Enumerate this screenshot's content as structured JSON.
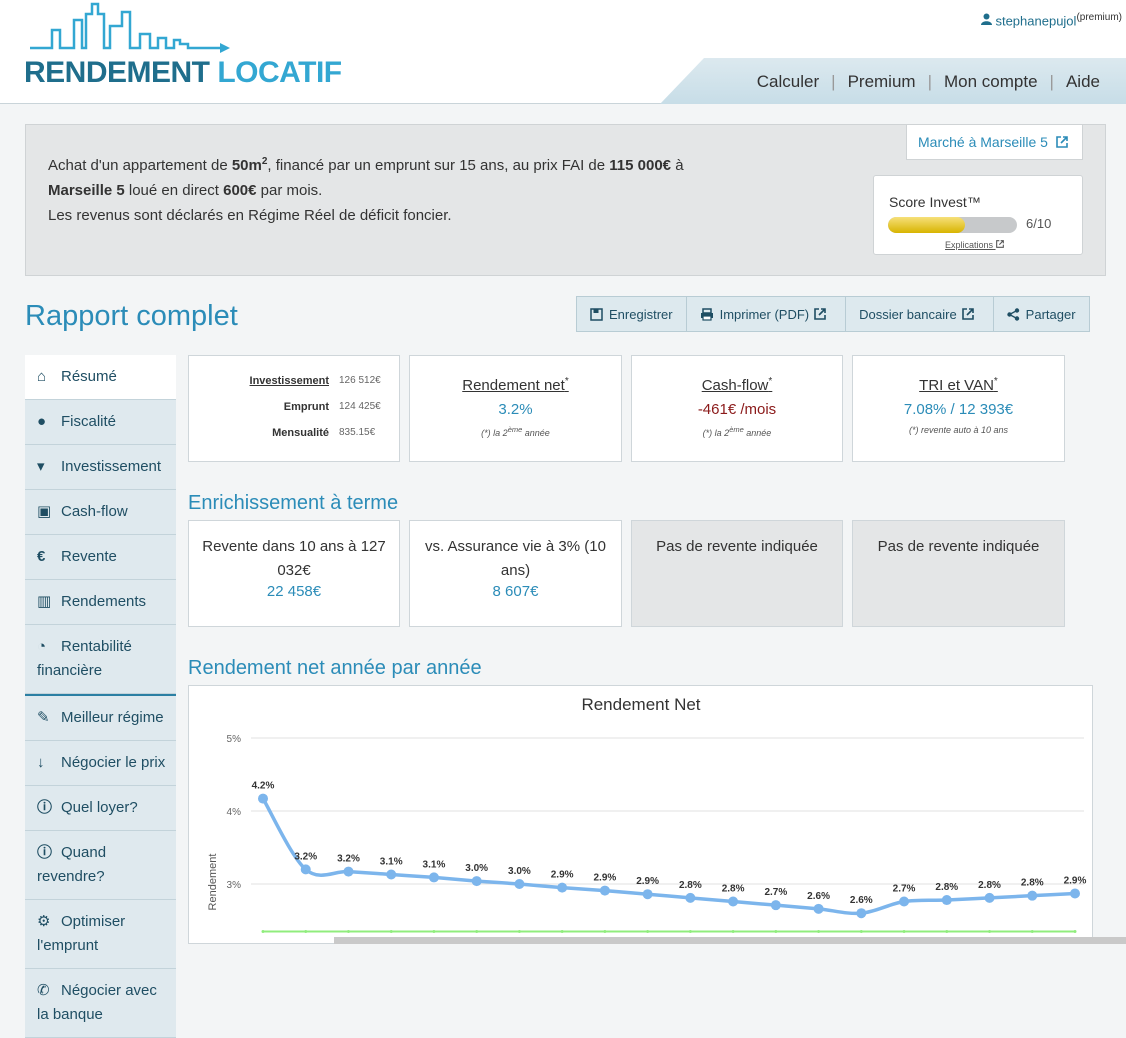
{
  "header": {
    "logo": {
      "part1": "RENDEMENT",
      "part2": "LOCATIF"
    },
    "user": {
      "name": "stephanepujol",
      "badge": "(premium)"
    },
    "nav": [
      "Calculer",
      "Premium",
      "Mon compte",
      "Aide"
    ]
  },
  "summary": {
    "t1": "Achat d'un appartement de ",
    "surface": "50m",
    "surface_sup": "2",
    "t2": ", financé par un emprunt sur 15 ans, au prix FAI de ",
    "price": "115 000€",
    "t3": " à",
    "city": "Marseille 5",
    "t4": " loué en direct ",
    "rent": "600€",
    "t5": " par mois.",
    "t6": "Les revenus sont déclarés en Régime Réel de déficit foncier.",
    "market_link": "Marché à Marseille 5",
    "score": {
      "title": "Score Invest™",
      "value": "6/10",
      "fraction": 0.6,
      "link": "Explications"
    }
  },
  "page_title": "Rapport complet",
  "toolbar": {
    "save": "Enregistrer",
    "print": "Imprimer (PDF)",
    "bank": "Dossier bancaire",
    "share": "Partager"
  },
  "sidebar": [
    {
      "label": "Résumé",
      "icon": "home-icon"
    },
    {
      "label": "Fiscalité",
      "icon": "user-icon"
    },
    {
      "label": "Investissement",
      "icon": "cart-icon"
    },
    {
      "label": "Cash-flow",
      "icon": "money-icon"
    },
    {
      "label": "Revente",
      "icon": "euro-icon"
    },
    {
      "label": "Rendements",
      "icon": "bar-chart-icon"
    },
    {
      "label": "Rentabilité financière",
      "icon": "dashboard-icon"
    },
    {
      "label": "Meilleur régime",
      "icon": "magic-wand-icon"
    },
    {
      "label": "Négocier le prix",
      "icon": "sort-down-icon"
    },
    {
      "label": "Quel loyer?",
      "icon": "info-icon"
    },
    {
      "label": "Quand revendre?",
      "icon": "info-icon"
    },
    {
      "label": "Optimiser l'emprunt",
      "icon": "gears-icon"
    },
    {
      "label": "Négocier avec la banque",
      "icon": "phone-icon"
    }
  ],
  "cards": {
    "investment": {
      "rows": [
        {
          "label": "Investissement",
          "value": "126 512€"
        },
        {
          "label": "Emprunt",
          "value": "124 425€"
        },
        {
          "label": "Mensualité",
          "value": "835.15€"
        }
      ]
    },
    "rendement": {
      "title": "Rendement net",
      "value": "3.2%",
      "note_pre": "(*) la 2",
      "note_sup": "ème",
      "note_post": " année"
    },
    "cashflow": {
      "title": "Cash-flow",
      "value": "-461€ /mois",
      "note_pre": "(*) la 2",
      "note_sup": "ème",
      "note_post": " année"
    },
    "tri": {
      "title": "TRI et VAN",
      "value": "7.08% / 12 393€",
      "note": "(*) revente auto à 10 ans"
    }
  },
  "enrichment": {
    "title": "Enrichissement à terme",
    "cards": [
      {
        "text": "Revente dans 10 ans à 127 032€",
        "value": "22 458€"
      },
      {
        "text": "vs. Assurance vie à 3% (10 ans)",
        "value": "8 607€"
      },
      {
        "text": "Pas de revente indiquée"
      },
      {
        "text": "Pas de revente indiquée"
      }
    ]
  },
  "chart_section_title": "Rendement net année par année",
  "chart_data": {
    "type": "line",
    "title": "Rendement Net",
    "ylabel": "Rendement",
    "ylim": [
      2.25,
      5.0
    ],
    "yticks": [
      "5%",
      "4%",
      "3%"
    ],
    "ytick_values": [
      5,
      4,
      3
    ],
    "series": [
      {
        "values": [
          4.17,
          3.2,
          3.17,
          3.13,
          3.09,
          3.04,
          3.0,
          2.95,
          2.91,
          2.86,
          2.81,
          2.76,
          2.71,
          2.66,
          2.6,
          2.76,
          2.78,
          2.81,
          2.84,
          2.87
        ],
        "labels": [
          "4.2%",
          "3.2%",
          "3.2%",
          "3.1%",
          "3.1%",
          "3.0%",
          "3.0%",
          "2.9%",
          "2.9%",
          "2.9%",
          "2.8%",
          "2.8%",
          "2.7%",
          "2.6%",
          "2.6%",
          "2.7%",
          "2.8%",
          "2.8%",
          "2.8%",
          "2.9%"
        ],
        "color": "#7cb5ec"
      },
      {
        "values": [
          2.35,
          2.35,
          2.35,
          2.35,
          2.35,
          2.35,
          2.35,
          2.35,
          2.35,
          2.35,
          2.35,
          2.35,
          2.35,
          2.35,
          2.35,
          2.35,
          2.35,
          2.35,
          2.35,
          2.35
        ],
        "color": "#90ed7d"
      }
    ]
  },
  "colors": {
    "accent": "#2b8cb8",
    "dark": "#1f6e8c",
    "negative": "#8b1a1a",
    "score_fill": "#e6c200"
  }
}
